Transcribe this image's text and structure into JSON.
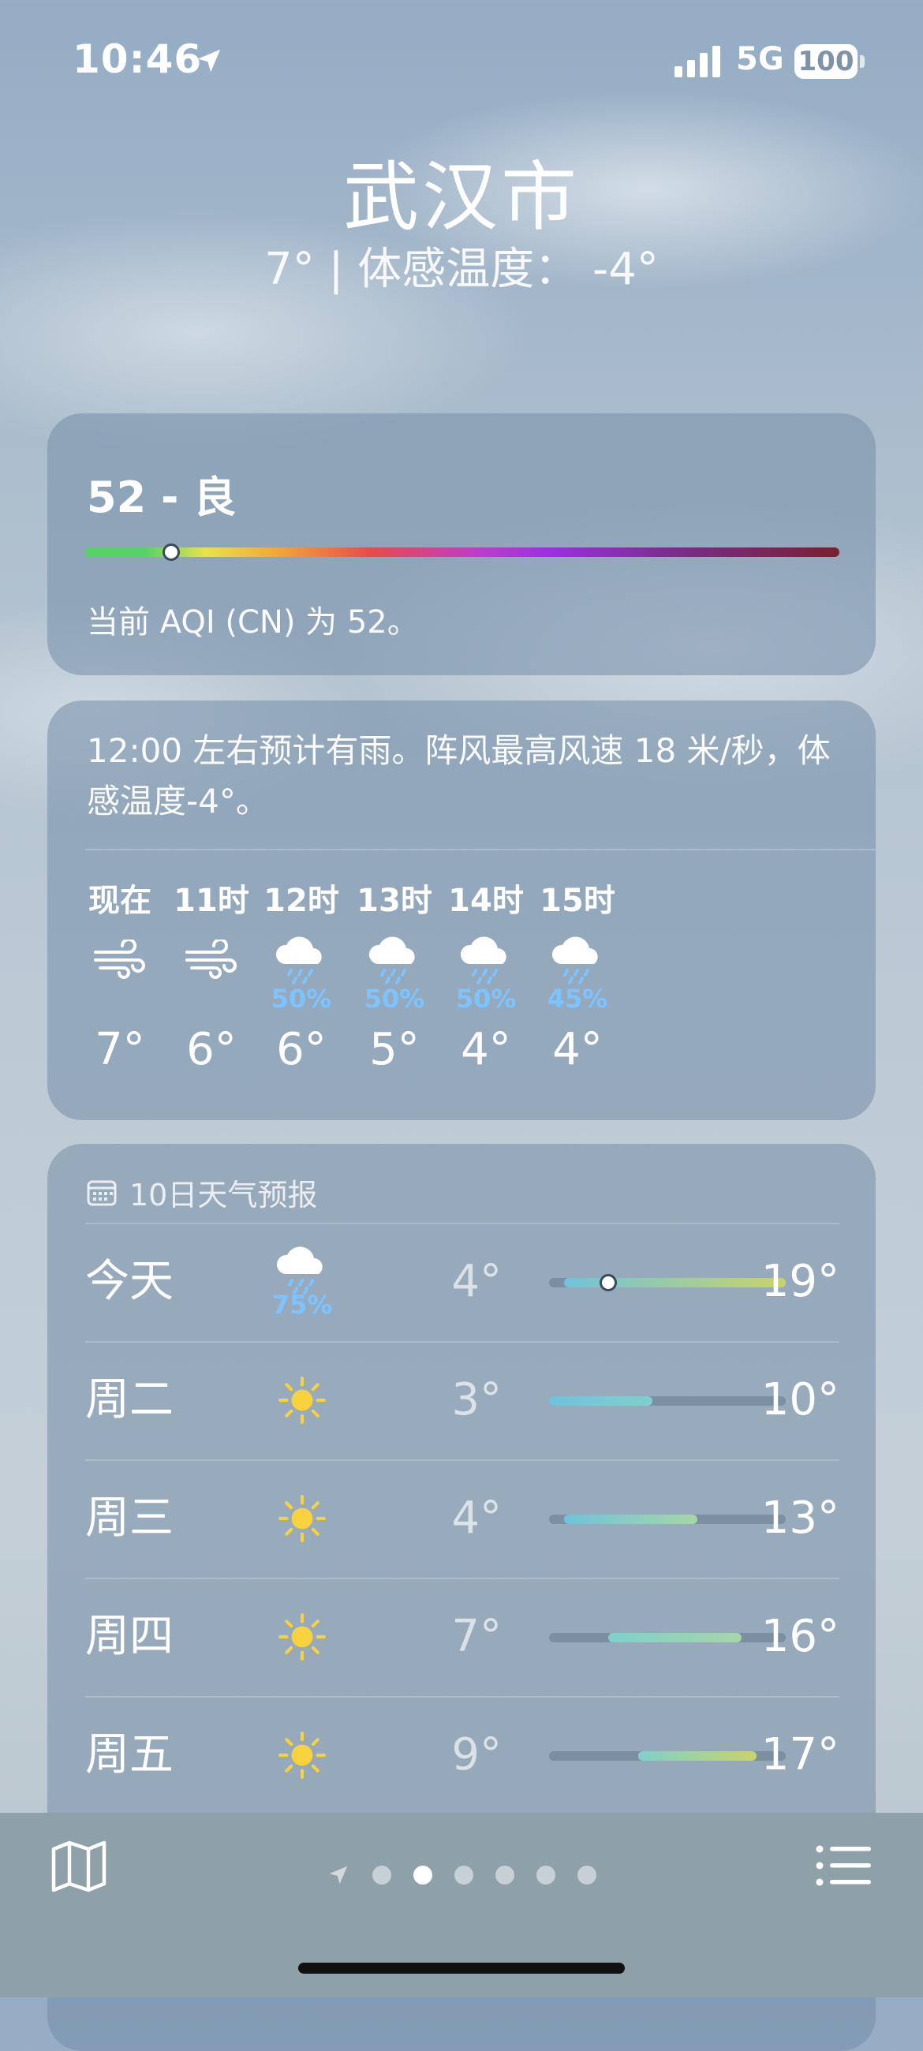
{
  "status_bar": {
    "time": "10:46",
    "network": "5G",
    "battery": "100"
  },
  "header": {
    "city": "武汉市",
    "summary": "7° | 体感温度： -4°"
  },
  "aqi": {
    "value_label": "52 - 良",
    "description": "当前 AQI (CN) 为 52。",
    "index": 52
  },
  "hourly": {
    "summary": "12:00 左右预计有雨。阵风最高风速 18 米/秒，体感温度-4°。",
    "hours": [
      {
        "label": "现在",
        "icon": "wind-icon",
        "pct": "",
        "temp": "7°"
      },
      {
        "label": "11时",
        "icon": "wind-icon",
        "pct": "",
        "temp": "6°"
      },
      {
        "label": "12时",
        "icon": "rain-cloud-icon",
        "pct": "50%",
        "temp": "6°"
      },
      {
        "label": "13时",
        "icon": "rain-cloud-icon",
        "pct": "50%",
        "temp": "5°"
      },
      {
        "label": "14时",
        "icon": "rain-cloud-icon",
        "pct": "50%",
        "temp": "4°"
      },
      {
        "label": "15时",
        "icon": "rain-cloud-icon",
        "pct": "45%",
        "temp": "4°"
      }
    ]
  },
  "daily": {
    "title": "10日天气预报",
    "days": [
      {
        "name": "今天",
        "icon": "rain-cloud-icon",
        "pct": "75%",
        "low": "4°",
        "high": "19°",
        "range": [
          4,
          19
        ],
        "current": 7
      },
      {
        "name": "周二",
        "icon": "sun-icon",
        "pct": "",
        "low": "3°",
        "high": "10°",
        "range": [
          3,
          10
        ]
      },
      {
        "name": "周三",
        "icon": "sun-icon",
        "pct": "",
        "low": "4°",
        "high": "13°",
        "range": [
          4,
          13
        ]
      },
      {
        "name": "周四",
        "icon": "sun-icon",
        "pct": "",
        "low": "7°",
        "high": "16°",
        "range": [
          7,
          16
        ]
      },
      {
        "name": "周五",
        "icon": "sun-icon",
        "pct": "",
        "low": "9°",
        "high": "17°",
        "range": [
          9,
          17
        ]
      }
    ]
  },
  "toolbar": {
    "pages": 6,
    "active_page": 1
  },
  "colors": {
    "precip": "#7cc4ff",
    "sun": "#f7d23c",
    "card": "#748ea8"
  }
}
